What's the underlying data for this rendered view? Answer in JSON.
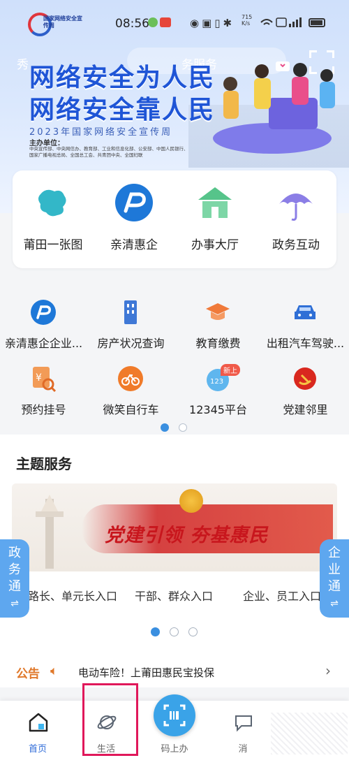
{
  "status_bar": {
    "time": "08:56",
    "net_speed_value": "715",
    "net_speed_unit": "K/s",
    "battery": ""
  },
  "banner": {
    "logo_text": "国家网络安全宣传周",
    "search_fragment": "秀",
    "search_placeholder": "务服务",
    "headline_line1": "网络安全为人民",
    "headline_line2": "网络安全靠人民",
    "year_line": "2023年国家网络安全宣传周",
    "org_label": "主办单位：",
    "org_names": "中央宣传部、中央网信办、教育部、工业和信息化部、公安部、中国人民银行、国家广播电视总局、全国总工会、共青团中央、全国妇联"
  },
  "quick_tiles": [
    {
      "label": "莆田一张图",
      "icon": "map-icon"
    },
    {
      "label": "亲清惠企",
      "icon": "qinqing-logo-icon"
    },
    {
      "label": "办事大厅",
      "icon": "hall-building-icon"
    },
    {
      "label": "政务互动",
      "icon": "umbrella-icon"
    }
  ],
  "services_row1": [
    {
      "label": "亲清惠企企业...",
      "icon": "qinqing-logo-icon"
    },
    {
      "label": "房产状况查询",
      "icon": "building-icon"
    },
    {
      "label": "教育缴费",
      "icon": "graduation-cap-icon"
    },
    {
      "label": "出租汽车驾驶...",
      "icon": "car-icon"
    }
  ],
  "services_row2": [
    {
      "label": "预约挂号",
      "icon": "registration-icon"
    },
    {
      "label": "微笑自行车",
      "icon": "bicycle-icon"
    },
    {
      "label": "12345平台",
      "icon": "hotline-icon",
      "badge": "新上"
    },
    {
      "label": "党建邻里",
      "icon": "party-emblem-icon"
    }
  ],
  "services_pager": {
    "active_index": 0,
    "count": 2
  },
  "theme": {
    "title": "主题服务",
    "banner_headline": "党建引领  夯基惠民",
    "links": [
      "路长、单元长入口",
      "干部、群众入口",
      "企业、员工入口"
    ],
    "pager": {
      "active_index": 0,
      "count": 3
    }
  },
  "side_tabs": {
    "left": "政务通",
    "right": "企业通"
  },
  "notice": {
    "tag": "公告",
    "text": "电动车险！上莆田惠民宝投保"
  },
  "tab_bar": {
    "items": [
      {
        "label": "首页",
        "icon": "home-icon",
        "active": true
      },
      {
        "label": "生活",
        "icon": "planet-icon",
        "active": false
      },
      {
        "label": "码上办",
        "icon": "scan-code-icon",
        "active": false
      },
      {
        "label": "消",
        "icon": "message-icon",
        "active": false
      }
    ]
  },
  "colors": {
    "accent": "#2f6bd8",
    "headline": "#1f55d6",
    "notice": "#e0782a",
    "party_red": "#c8161d",
    "side_tab": "#5ea7ef"
  }
}
